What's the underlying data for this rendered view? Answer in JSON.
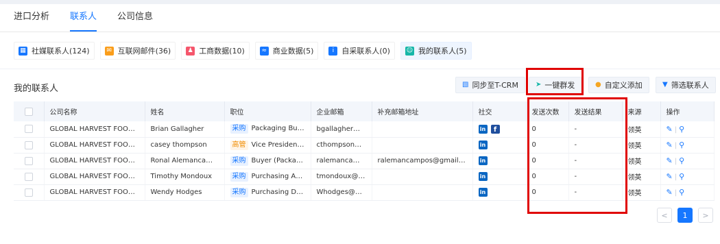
{
  "tabs": [
    {
      "label": "进口分析",
      "active": false
    },
    {
      "label": "联系人",
      "active": true
    },
    {
      "label": "公司信息",
      "active": false
    }
  ],
  "chips": [
    {
      "label": "社媒联系人(124)",
      "icon": "social-icon",
      "color": "#1677ff",
      "active": false
    },
    {
      "label": "互联网邮件(36)",
      "icon": "mail-icon",
      "color": "#fa9d1a",
      "active": false
    },
    {
      "label": "工商数据(10)",
      "icon": "business-icon",
      "color": "#f5566c",
      "active": false
    },
    {
      "label": "商业数据(5)",
      "icon": "chart-icon",
      "color": "#1677ff",
      "active": false
    },
    {
      "label": "自采联系人(0)",
      "icon": "contact-card-icon",
      "color": "#1677ff",
      "active": false
    },
    {
      "label": "我的联系人(5)",
      "icon": "person-card-icon",
      "color": "#16b6a8",
      "active": true
    }
  ],
  "section_title": "我的联系人",
  "toolbar": {
    "sync_label": "同步至T-CRM",
    "bulk_send_label": "一键群发",
    "custom_add_label": "自定义添加",
    "filter_label": "筛选联系人"
  },
  "columns": [
    "公司名称",
    "姓名",
    "职位",
    "企业邮箱",
    "补充邮箱地址",
    "社交",
    "发送次数",
    "发送结果",
    "来源",
    "操作"
  ],
  "rows": [
    {
      "company": "GLOBAL HARVEST FOODS LTD",
      "name": "Brian Gallagher",
      "tag": "采购",
      "tag_color": "blue",
      "position": "Packaging Buyer",
      "email": "bgallagher@ghfoo...",
      "extra_email": "",
      "facebook": true,
      "send_count": "0",
      "send_result": "-",
      "source": "领英"
    },
    {
      "company": "GLOBAL HARVEST FOODS LTD",
      "name": "casey thompson",
      "tag": "高管",
      "tag_color": "orange",
      "position": "Vice President Sup...",
      "email": "cthompson@ghfo...",
      "extra_email": "",
      "facebook": false,
      "send_count": "0",
      "send_result": "-",
      "source": "领英"
    },
    {
      "company": "GLOBAL HARVEST FOODS LTD",
      "name": "Ronal Alemancampos",
      "tag": "采购",
      "tag_color": "blue",
      "position": "Buyer (Packaging)",
      "email": "ralemancampos@...",
      "extra_email": "ralemancampos@gmail.com",
      "facebook": false,
      "send_count": "0",
      "send_result": "-",
      "source": "领英"
    },
    {
      "company": "GLOBAL HARVEST FOODS LTD",
      "name": "Timothy Mondoux",
      "tag": "采购",
      "tag_color": "blue",
      "position": "Purchasing Agent",
      "email": "tmondoux@ghfoo...",
      "extra_email": "",
      "facebook": false,
      "send_count": "0",
      "send_result": "-",
      "source": "领英"
    },
    {
      "company": "GLOBAL HARVEST FOODS LTD",
      "name": "Wendy Hodges",
      "tag": "采购",
      "tag_color": "blue",
      "position": "Purchasing Depart...",
      "email": "Whodges@ghfood...",
      "extra_email": "",
      "facebook": false,
      "send_count": "0",
      "send_result": "-",
      "source": "领英"
    }
  ],
  "pagination": {
    "prev": "<",
    "current": "1",
    "next": ">"
  },
  "colors": {
    "accent": "#1677ff",
    "highlight": "#e00000"
  }
}
